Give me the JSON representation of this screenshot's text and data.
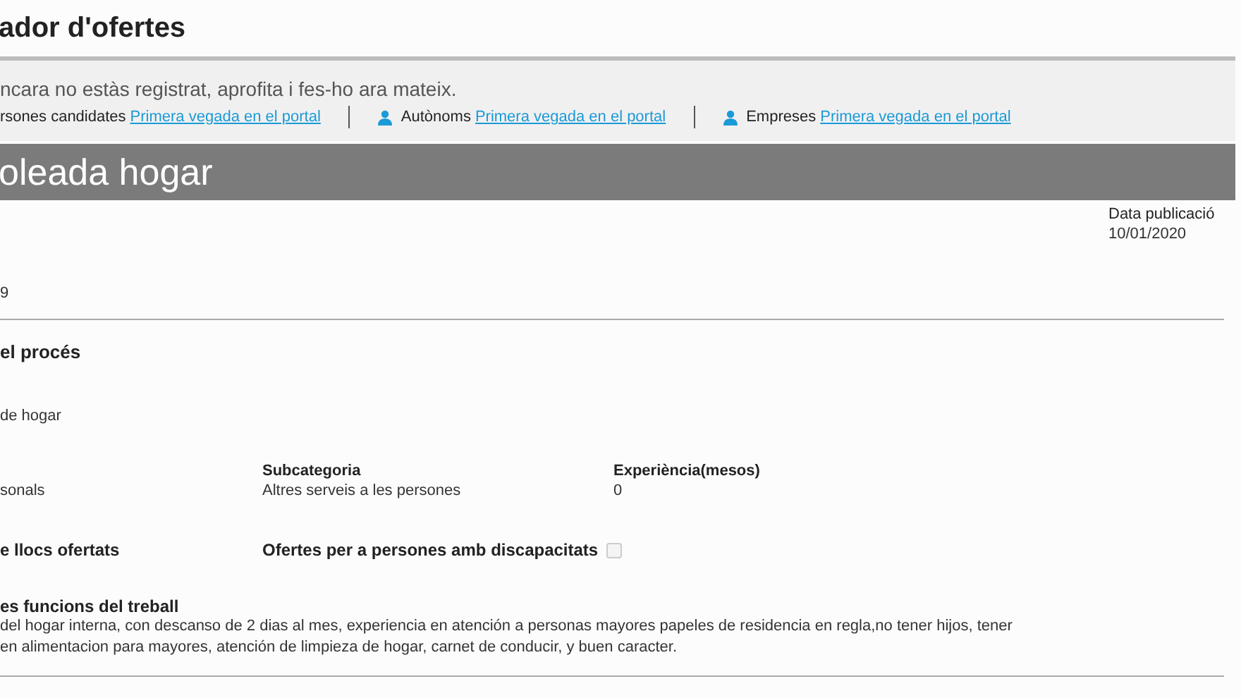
{
  "page_title": "ador d'ofertes",
  "notice": {
    "message": "ncara no estàs registrat, aprofita i fes-ho ara mateix.",
    "links": [
      {
        "label": "rsones candidates",
        "link": "Primera vegada en el portal",
        "kind": "plain"
      },
      {
        "label": "Autònoms",
        "link": "Primera vegada en el portal",
        "kind": "person"
      },
      {
        "label": "Empreses",
        "link": "Primera vegada en el portal",
        "kind": "person"
      }
    ]
  },
  "offer": {
    "title": "oleada hogar",
    "date_label": "Data publicació",
    "date": "10/01/2020",
    "field_value": "9"
  },
  "process": {
    "heading": "el procés",
    "occupation": "de hogar",
    "category_value": "sonals",
    "subcategory_label": "Subcategoria",
    "subcategory_value": "Altres serveis a les persones",
    "experience_label": "Experiència(mesos)",
    "experience_value": "0",
    "places_label": "e llocs ofertats",
    "disability_label": "Ofertes per a persones amb discapacitats",
    "disability_checked": false,
    "functions_label": "es funcions del treball",
    "functions_lines": [
      "del hogar interna, con descanso de 2 dias al mes, experiencia en atención a personas mayores papeles de residencia en regla,no tener hijos, tener",
      "en alimentacion para mayores, atención de limpieza de hogar, carnet de conducir, y buen caracter."
    ]
  }
}
